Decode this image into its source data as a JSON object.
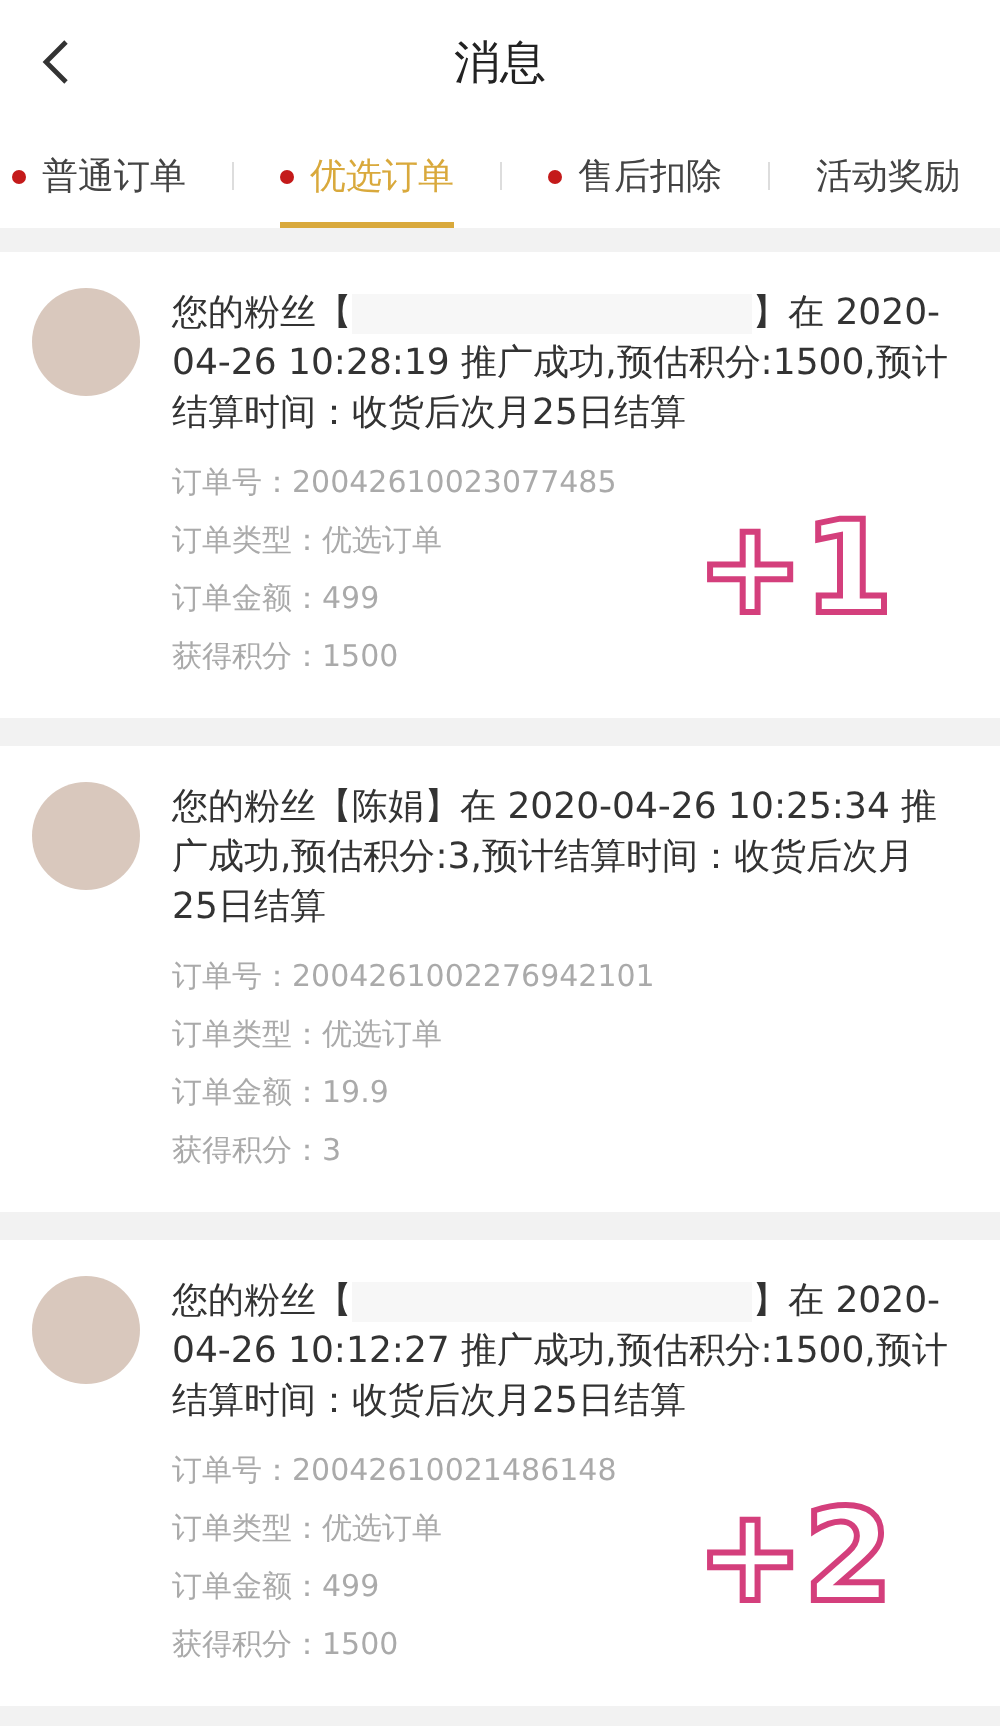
{
  "header": {
    "title": "消息"
  },
  "tabs": [
    {
      "label": "普通订单",
      "selected": false,
      "dot": true
    },
    {
      "label": "优选订单",
      "selected": true,
      "dot": true
    },
    {
      "label": "售后扣除",
      "selected": false,
      "dot": true
    },
    {
      "label": "活动奖励",
      "selected": false,
      "dot": false
    }
  ],
  "messages": [
    {
      "before": "您的粉丝【",
      "redacted": true,
      "after": "】在 2020-04-26 10:28:19 推广成功,预估积分:1500,预计结算时间：收货后次月25日结算",
      "details": [
        {
          "label": "订单号：",
          "value": "20042610023077485"
        },
        {
          "label": "订单类型：",
          "value": "优选订单"
        },
        {
          "label": "订单金额：",
          "value": "499"
        },
        {
          "label": "获得积分：",
          "value": "1500"
        }
      ],
      "annotation": "+1"
    },
    {
      "before": "您的粉丝【陈娟】在 2020-04-26 10:25:34 推广成功,预估积分:3,预计结算时间：收货后次月25日结算",
      "details": [
        {
          "label": "订单号：",
          "value": "2004261002276942101"
        },
        {
          "label": "订单类型：",
          "value": "优选订单"
        },
        {
          "label": "订单金额：",
          "value": "19.9"
        },
        {
          "label": "获得积分：",
          "value": "3"
        }
      ]
    },
    {
      "before": "您的粉丝【",
      "redacted": true,
      "after": "】在 2020-04-26 10:12:27 推广成功,预估积分:1500,预计结算时间：收货后次月25日结算",
      "details": [
        {
          "label": "订单号：",
          "value": "20042610021486148"
        },
        {
          "label": "订单类型：",
          "value": "优选订单"
        },
        {
          "label": "订单金额：",
          "value": "499"
        },
        {
          "label": "获得积分：",
          "value": "1500"
        }
      ],
      "annotation": "+2"
    }
  ]
}
